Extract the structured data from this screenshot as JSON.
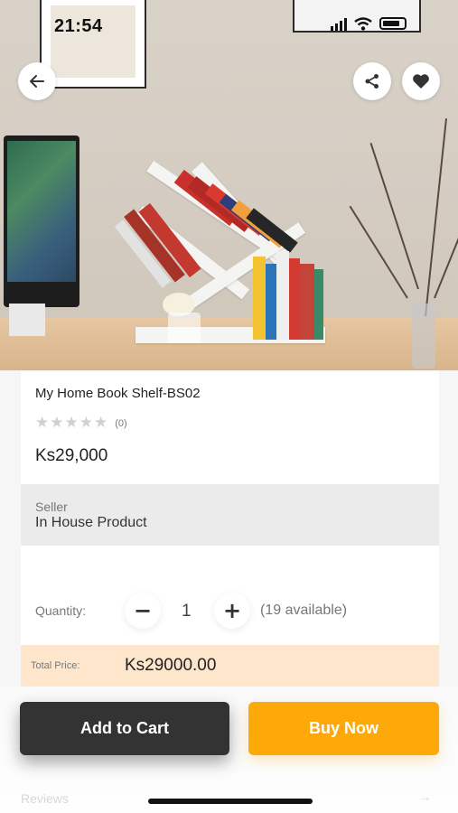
{
  "status_bar": {
    "time": "21:54"
  },
  "product": {
    "title": "My Home Book Shelf-BS02",
    "review_count": "(0)",
    "rating": 0,
    "rating_max": 5,
    "price": "Ks29,000"
  },
  "seller": {
    "label": "Seller",
    "name": "In House Product"
  },
  "quantity": {
    "label": "Quantity:",
    "decrement_symbol": "−",
    "value": "1",
    "increment_symbol": "+",
    "available": "(19 available)"
  },
  "total": {
    "label": "Total Price:",
    "value": "Ks29000.00"
  },
  "reviews": {
    "label": "Reviews",
    "arrow": "→"
  },
  "actions": {
    "add_to_cart": "Add to Cart",
    "buy_now": "Buy Now"
  },
  "colors": {
    "buy_now": "#fca909",
    "add_to_cart": "#333333",
    "total_bg": "#fde6cc",
    "seller_bg": "#ebebeb"
  },
  "icons": [
    "back-arrow-icon",
    "share-icon",
    "heart-icon",
    "star-icon",
    "signal-icon",
    "wifi-icon",
    "battery-icon"
  ]
}
